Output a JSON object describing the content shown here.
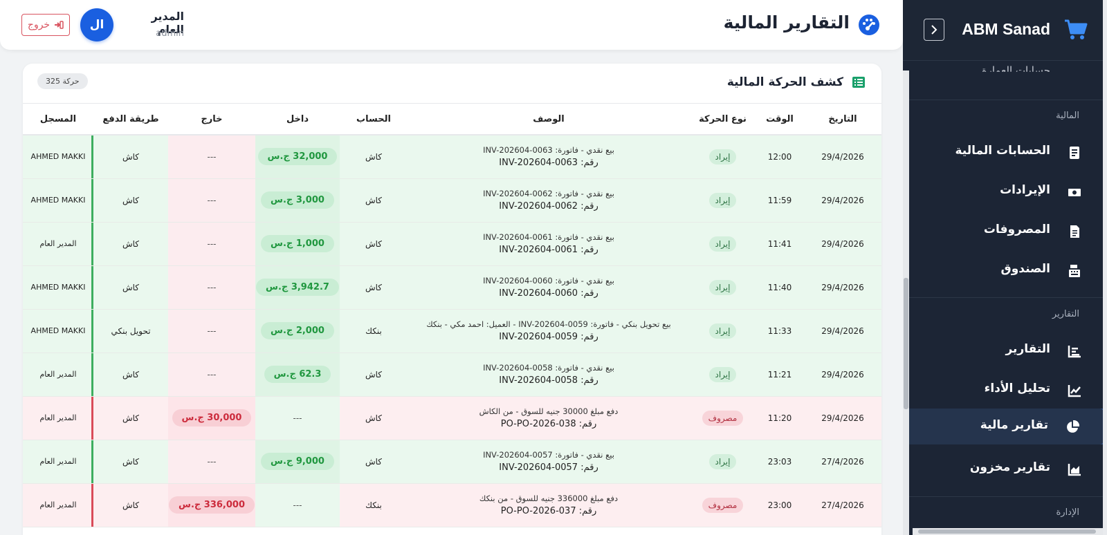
{
  "sidebar": {
    "brand": "ABM Sanad",
    "partial_item": "حسابات العمارة",
    "sections": {
      "finance": "المالية",
      "reports": "التقارير",
      "admin": "الإدارة"
    },
    "items": [
      {
        "label": "الحسابات المالية",
        "icon": "ledger-icon"
      },
      {
        "label": "الإيرادات",
        "icon": "money-bill-icon"
      },
      {
        "label": "المصروفات",
        "icon": "receipt-icon"
      },
      {
        "label": "الصندوق",
        "icon": "cash-register-icon"
      },
      {
        "label": "التقارير",
        "icon": "bar-chart-icon"
      },
      {
        "label": "تحليل الأداء",
        "icon": "line-chart-icon"
      },
      {
        "label": "تقارير مالية",
        "icon": "pie-chart-icon",
        "active": true
      },
      {
        "label": "تقارير مخزون",
        "icon": "area-chart-icon"
      }
    ]
  },
  "header": {
    "title": "التقارير المالية",
    "user_name": "المدير العام",
    "user_role": "admin",
    "avatar_initials": "ال",
    "logout_label": "خروج"
  },
  "card": {
    "title": "كشف الحركة المالية",
    "count": "325 حركة"
  },
  "table": {
    "columns": [
      "التاريخ",
      "الوقت",
      "نوع الحركة",
      "الوصف",
      "الحساب",
      "داخل",
      "خارج",
      "طريقة الدفع",
      "المسجل"
    ],
    "rows": [
      {
        "kind": "income",
        "date": "29/4/2026",
        "time": "12:00",
        "type": "إيراد",
        "desc1": "بيع نقدي - فاتورة: INV-202604-0063",
        "desc2": "رقم: INV-202604-0063",
        "account": "كاش",
        "in": "32,000 ج.س",
        "out": "---",
        "method": "كاش",
        "by": "AHMED MAKKI"
      },
      {
        "kind": "income",
        "date": "29/4/2026",
        "time": "11:59",
        "type": "إيراد",
        "desc1": "بيع نقدي - فاتورة: INV-202604-0062",
        "desc2": "رقم: INV-202604-0062",
        "account": "كاش",
        "in": "3,000 ج.س",
        "out": "---",
        "method": "كاش",
        "by": "AHMED MAKKI"
      },
      {
        "kind": "income",
        "date": "29/4/2026",
        "time": "11:41",
        "type": "إيراد",
        "desc1": "بيع نقدي - فاتورة: INV-202604-0061",
        "desc2": "رقم: INV-202604-0061",
        "account": "كاش",
        "in": "1,000 ج.س",
        "out": "---",
        "method": "كاش",
        "by": "المدير العام"
      },
      {
        "kind": "income",
        "date": "29/4/2026",
        "time": "11:40",
        "type": "إيراد",
        "desc1": "بيع نقدي - فاتورة: INV-202604-0060",
        "desc2": "رقم: INV-202604-0060",
        "account": "كاش",
        "in": "3,942.7 ج.س",
        "out": "---",
        "method": "كاش",
        "by": "AHMED MAKKI"
      },
      {
        "kind": "income",
        "date": "29/4/2026",
        "time": "11:33",
        "type": "إيراد",
        "desc1": "بيع تحويل بنكي - فاتورة: INV-202604-0059 - العميل: احمد مكي - بنكك",
        "desc2": "رقم: INV-202604-0059",
        "account": "بنكك",
        "in": "2,000 ج.س",
        "out": "---",
        "method": "تحويل بنكي",
        "by": "AHMED MAKKI"
      },
      {
        "kind": "income",
        "date": "29/4/2026",
        "time": "11:21",
        "type": "إيراد",
        "desc1": "بيع نقدي - فاتورة: INV-202604-0058",
        "desc2": "رقم: INV-202604-0058",
        "account": "كاش",
        "in": "62.3 ج.س",
        "out": "---",
        "method": "كاش",
        "by": "المدير العام"
      },
      {
        "kind": "expense",
        "date": "29/4/2026",
        "time": "11:20",
        "type": "مصروف",
        "desc1": "دفع مبلغ 30000 جنيه للسوق - من الكاش",
        "desc2": "رقم: PO-PO-2026-038",
        "account": "كاش",
        "in": "---",
        "out": "30,000 ج.س",
        "method": "كاش",
        "by": "المدير العام"
      },
      {
        "kind": "income",
        "date": "27/4/2026",
        "time": "23:03",
        "type": "إيراد",
        "desc1": "بيع نقدي - فاتورة: INV-202604-0057",
        "desc2": "رقم: INV-202604-0057",
        "account": "كاش",
        "in": "9,000 ج.س",
        "out": "---",
        "method": "كاش",
        "by": "المدير العام"
      },
      {
        "kind": "expense",
        "date": "27/4/2026",
        "time": "23:00",
        "type": "مصروف",
        "desc1": "دفع مبلغ 336000 جنيه للسوق - من بنكك",
        "desc2": "رقم: PO-PO-2026-037",
        "account": "بنكك",
        "in": "---",
        "out": "336,000 ج.س",
        "method": "كاش",
        "by": "المدير العام"
      }
    ]
  },
  "colors": {
    "sidebar_bg": "#1c2535",
    "accent": "#1a5fe0",
    "income_green": "#20973f",
    "expense_red": "#cc2b3c"
  }
}
